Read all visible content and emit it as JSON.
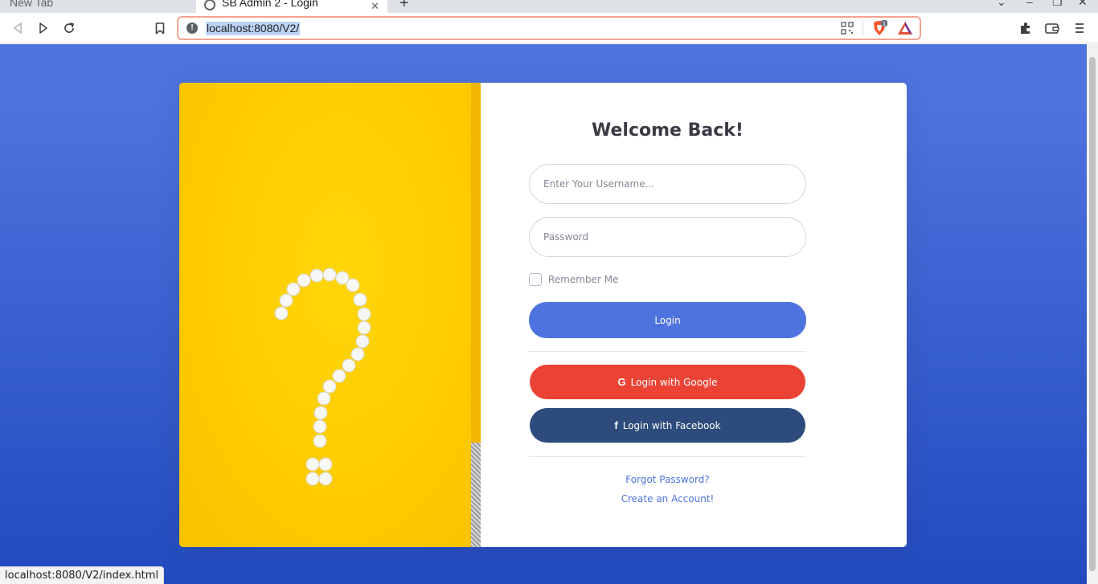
{
  "browser": {
    "tabs": [
      {
        "title": "New Tab",
        "active": false
      },
      {
        "title": "SB Admin 2 - Login",
        "active": true
      }
    ],
    "address_bar": {
      "url": "localhost:8080/V2/"
    },
    "brave_shields_count": "1",
    "status_url": "localhost:8080/V2/index.html"
  },
  "login": {
    "heading": "Welcome Back!",
    "username_placeholder": "Enter Your Username...",
    "password_placeholder": "Password",
    "remember_label": "Remember Me",
    "remember_checked": false,
    "login_button": "Login",
    "google_button": "Login with Google",
    "facebook_button": "Login with Facebook",
    "forgot_link": "Forgot Password?",
    "create_link": "Create an Account!"
  },
  "colors": {
    "primary": "#4e73df",
    "google": "#ea4335",
    "facebook": "#2d4b7c",
    "image_yellow": "#fcd104"
  }
}
